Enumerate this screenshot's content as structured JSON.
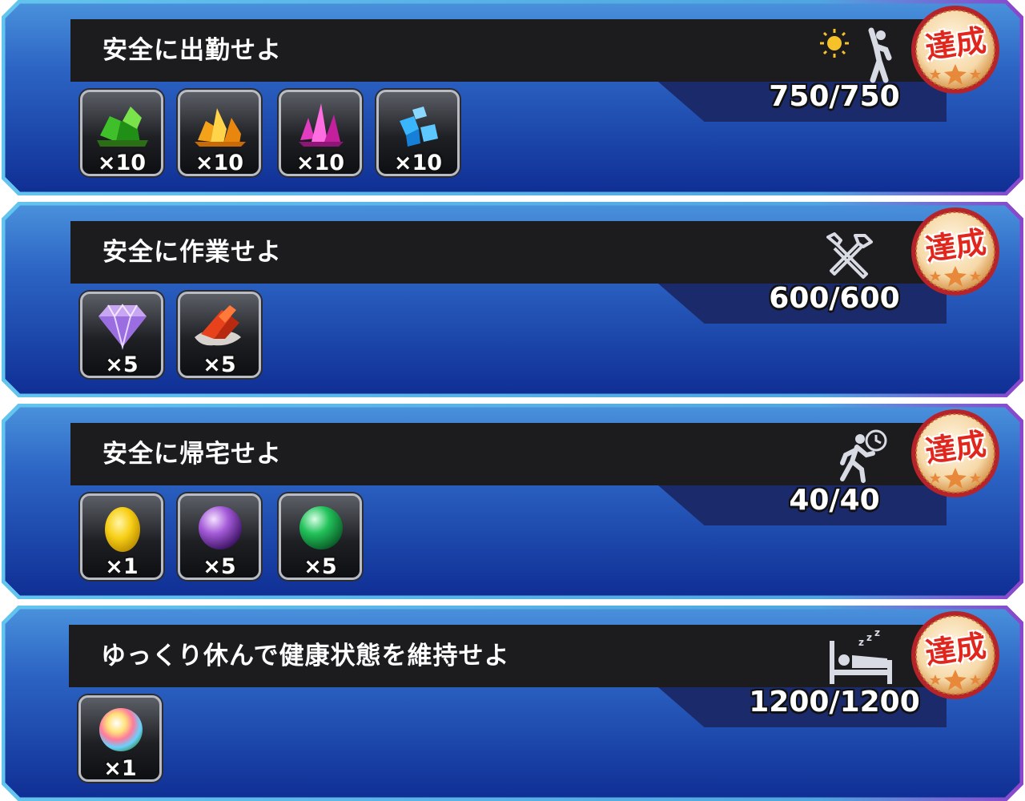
{
  "colors": {
    "panel_top": "#3a7fd0",
    "panel_bottom": "#123a9e",
    "panel_rim": "#5ab4e8",
    "panel_rim_right": "#7a3fc0",
    "title_bar": "#1c1c1f",
    "progress_bg": "#1b2a6b",
    "badge_text": "#e0261d"
  },
  "missions": [
    {
      "title": "安全に出勤せよ",
      "progress": "750/750",
      "progress_fraction": 1.0,
      "status": "達成",
      "icon": "commute-sun-icon",
      "rewards": [
        {
          "icon": "green-crystal-icon",
          "qty": "×10"
        },
        {
          "icon": "yellow-crystal-icon",
          "qty": "×10"
        },
        {
          "icon": "pink-crystal-icon",
          "qty": "×10"
        },
        {
          "icon": "blue-crystal-icon",
          "qty": "×10"
        }
      ]
    },
    {
      "title": "安全に作業せよ",
      "progress": "600/600",
      "progress_fraction": 1.0,
      "status": "達成",
      "icon": "tools-icon",
      "rewards": [
        {
          "icon": "diamond-icon",
          "qty": "×5"
        },
        {
          "icon": "red-crystal-ore-icon",
          "qty": "×5"
        }
      ]
    },
    {
      "title": "安全に帰宅せよ",
      "progress": "40/40",
      "progress_fraction": 1.0,
      "status": "達成",
      "icon": "walking-clock-icon",
      "rewards": [
        {
          "icon": "golden-egg-icon",
          "qty": "×1"
        },
        {
          "icon": "purple-orb-icon",
          "qty": "×5"
        },
        {
          "icon": "green-orb-icon",
          "qty": "×5"
        }
      ]
    },
    {
      "title": "ゆっくり休んで健康状態を維持せよ",
      "progress": "1200/1200",
      "progress_fraction": 1.0,
      "status": "達成",
      "icon": "sleeping-bed-icon",
      "rewards": [
        {
          "icon": "rainbow-orb-icon",
          "qty": "×1"
        }
      ]
    }
  ]
}
